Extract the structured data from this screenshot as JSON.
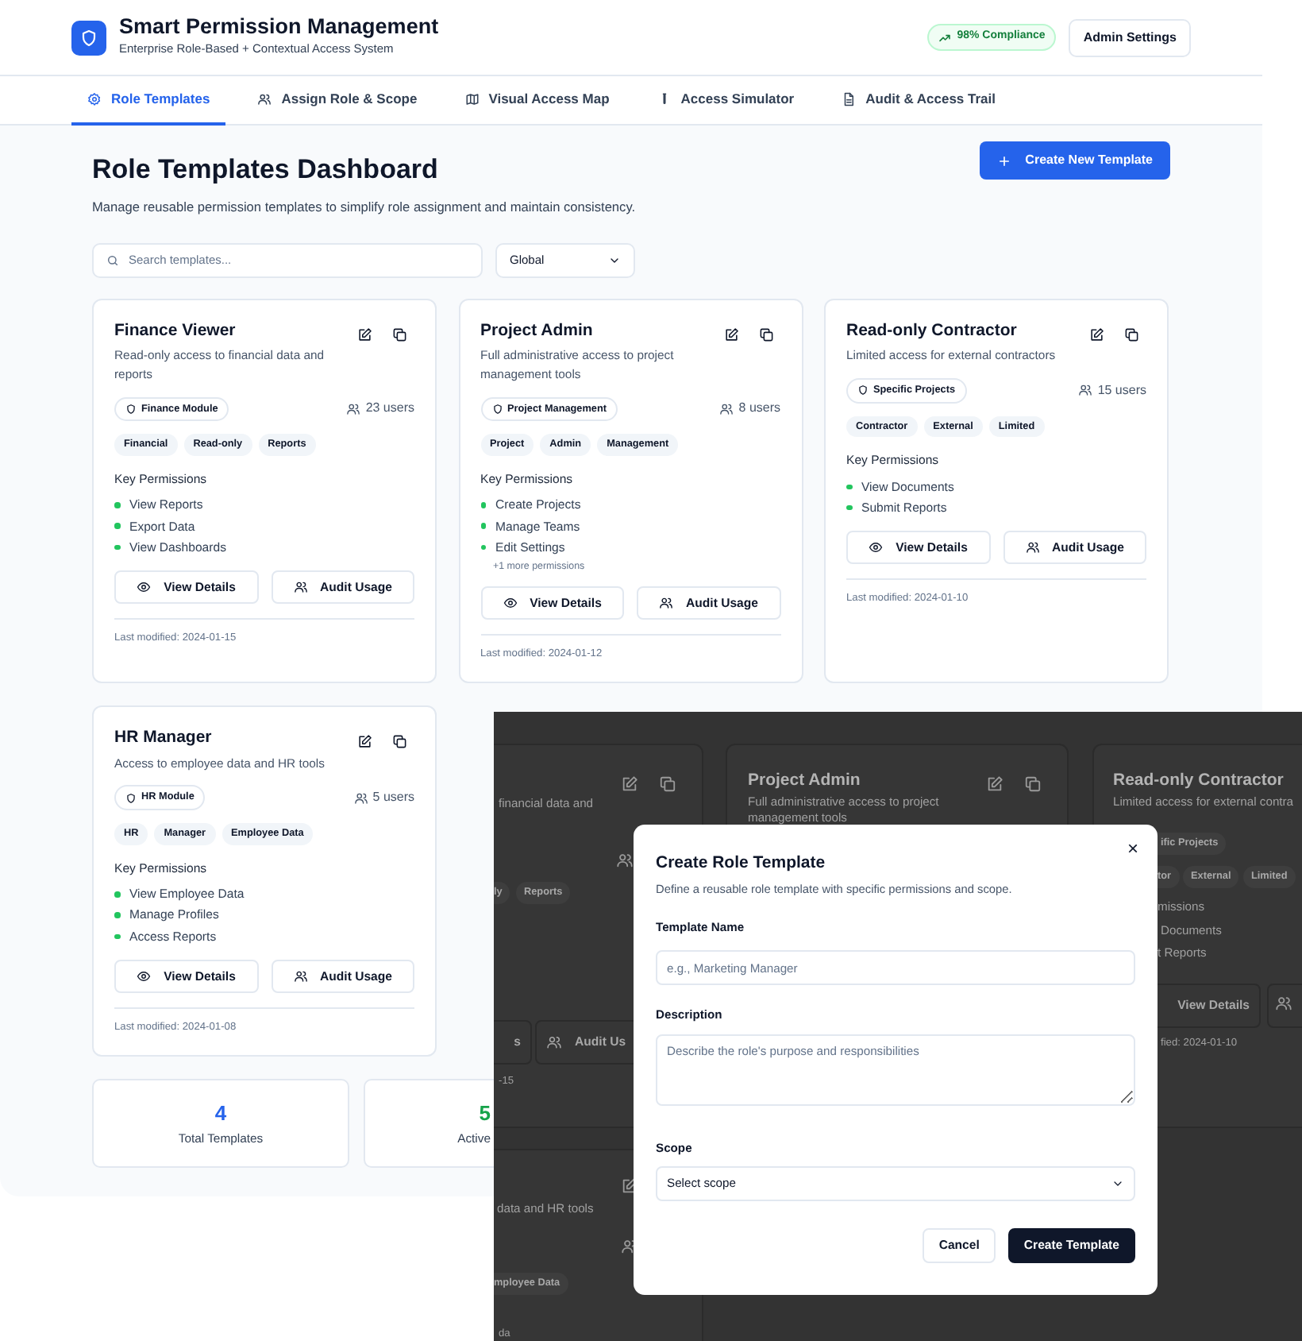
{
  "header": {
    "title": "Smart Permission Management",
    "subtitle": "Enterprise Role-Based + Contextual Access System",
    "compliance_badge": "98% Compliance",
    "admin_button": "Admin Settings"
  },
  "tabs": [
    {
      "label": "Role Templates",
      "selected": true
    },
    {
      "label": "Assign Role & Scope",
      "selected": false
    },
    {
      "label": "Visual Access Map",
      "selected": false
    },
    {
      "label": "Access Simulator",
      "selected": false
    },
    {
      "label": "Audit & Access Trail",
      "selected": false
    }
  ],
  "page": {
    "title": "Role Templates Dashboard",
    "subtitle": "Manage reusable permission templates to simplify role assignment and maintain consistency.",
    "create_button": "Create New Template"
  },
  "filters": {
    "search_placeholder": "Search templates...",
    "scope_value": "Global"
  },
  "templates": [
    {
      "name": "Finance Viewer",
      "description": "Read-only access to financial data and reports",
      "scope": "Finance Module",
      "users": "23 users",
      "tags": [
        "Financial",
        "Read-only",
        "Reports"
      ],
      "permissions_heading": "Key Permissions",
      "permissions": [
        "View Reports",
        "Export Data",
        "View Dashboards"
      ],
      "actions": [
        "View Details",
        "Audit Usage"
      ],
      "last_modified": "Last modified: 2024-01-15"
    },
    {
      "name": "Project Admin",
      "description": "Full administrative access to project management tools",
      "scope": "Project Management",
      "users": "8 users",
      "tags": [
        "Project",
        "Admin",
        "Management"
      ],
      "permissions_heading": "Key Permissions",
      "permissions": [
        "Create Projects",
        "Manage Teams",
        "Edit Settings"
      ],
      "more_permissions": "+1 more permissions",
      "actions": [
        "View Details",
        "Audit Usage"
      ],
      "last_modified": "Last modified: 2024-01-12"
    },
    {
      "name": "Read-only Contractor",
      "description": "Limited access for external contractors",
      "scope": "Specific Projects",
      "users": "15 users",
      "tags": [
        "Contractor",
        "External",
        "Limited"
      ],
      "permissions_heading": "Key Permissions",
      "permissions": [
        "View Documents",
        "Submit Reports"
      ],
      "actions": [
        "View Details",
        "Audit Usage"
      ],
      "last_modified": "Last modified: 2024-01-10"
    },
    {
      "name": "HR Manager",
      "description": "Access to employee data and HR tools",
      "scope": "HR Module",
      "users": "5 users",
      "tags": [
        "HR",
        "Manager",
        "Employee Data"
      ],
      "permissions_heading": "Key Permissions",
      "permissions": [
        "View Employee Data",
        "Manage Profiles",
        "Access Reports"
      ],
      "actions": [
        "View Details",
        "Audit Usage"
      ],
      "last_modified": "Last modified: 2024-01-08"
    }
  ],
  "stats": [
    {
      "value": "4",
      "label": "Total Templates",
      "color": "#2563eb"
    },
    {
      "value": "5",
      "label": "Active",
      "color": "#16a34a",
      "clipped": true
    }
  ],
  "backdrop": {
    "fragments": [
      {
        "kind": "text",
        "text": "financial data and"
      },
      {
        "kind": "tag",
        "text": "ly"
      },
      {
        "kind": "tag",
        "text": "Reports"
      },
      {
        "kind": "button",
        "text": "s"
      },
      {
        "kind": "button",
        "text": "Audit Us"
      },
      {
        "kind": "small",
        "text": "-15"
      },
      {
        "kind": "text",
        "text": "data and HR tools"
      },
      {
        "kind": "tag",
        "text": "mployee Data"
      },
      {
        "kind": "small",
        "text": "da"
      },
      {
        "kind": "title",
        "text": "Project Admin"
      },
      {
        "kind": "text",
        "text": "Full administrative access to project"
      },
      {
        "kind": "text",
        "text": "management tools"
      },
      {
        "kind": "title",
        "text": "Read-only Contractor"
      },
      {
        "kind": "text",
        "text": "Limited access for external contra"
      },
      {
        "kind": "tag",
        "text": "ific Projects"
      },
      {
        "kind": "tag",
        "text": "tor"
      },
      {
        "kind": "tag",
        "text": "External"
      },
      {
        "kind": "tag",
        "text": "Limited"
      },
      {
        "kind": "text",
        "text": "missions"
      },
      {
        "kind": "text",
        "text": "Documents"
      },
      {
        "kind": "text",
        "text": "t Reports"
      },
      {
        "kind": "button",
        "text": "View Details"
      },
      {
        "kind": "small",
        "text": "fied: 2024-01-10"
      }
    ]
  },
  "modal": {
    "title": "Create Role Template",
    "subtitle": "Define a reusable role template with specific permissions and scope.",
    "close": "×",
    "fields": [
      {
        "kind": "input",
        "label": "Template Name",
        "placeholder": "e.g., Marketing Manager"
      },
      {
        "kind": "textarea",
        "label": "Description",
        "placeholder": "Describe the role's purpose and responsibilities"
      },
      {
        "kind": "select",
        "label": "Scope",
        "value": "Select scope"
      }
    ],
    "buttons": [
      {
        "kind": "secondary",
        "label": "Cancel"
      },
      {
        "kind": "primary",
        "label": "Create Template"
      }
    ]
  }
}
